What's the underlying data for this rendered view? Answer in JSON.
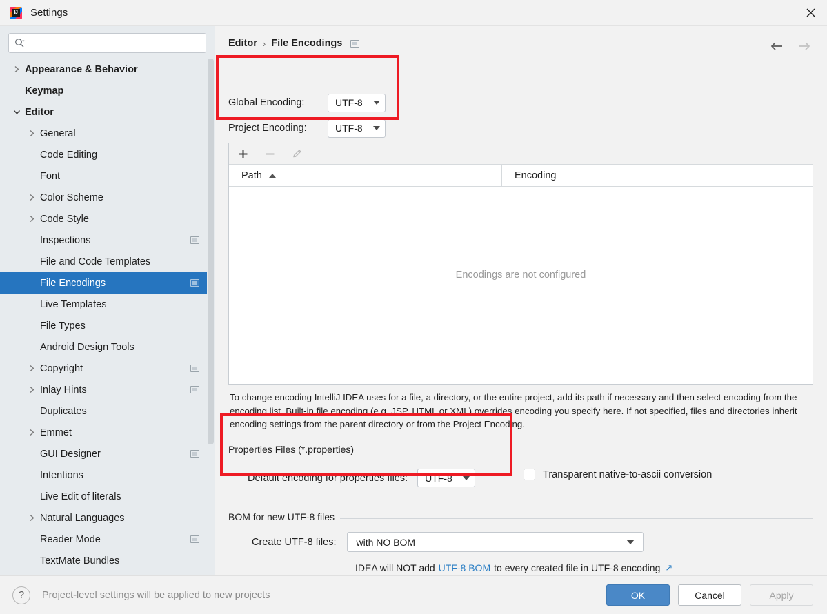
{
  "window": {
    "title": "Settings",
    "logo_text": "IJ",
    "close_icon": "close-icon"
  },
  "sidebar": {
    "search": {
      "value": "",
      "placeholder": ""
    },
    "items": [
      {
        "label": "Appearance & Behavior",
        "level": 0,
        "arrow": "collapsed",
        "badge": false,
        "selected": false
      },
      {
        "label": "Keymap",
        "level": 0,
        "arrow": "none",
        "badge": false,
        "selected": false
      },
      {
        "label": "Editor",
        "level": 0,
        "arrow": "expanded",
        "badge": false,
        "selected": false
      },
      {
        "label": "General",
        "level": 1,
        "arrow": "collapsed",
        "badge": false,
        "selected": false
      },
      {
        "label": "Code Editing",
        "level": 1,
        "arrow": "none",
        "badge": false,
        "selected": false
      },
      {
        "label": "Font",
        "level": 1,
        "arrow": "none",
        "badge": false,
        "selected": false
      },
      {
        "label": "Color Scheme",
        "level": 1,
        "arrow": "collapsed",
        "badge": false,
        "selected": false
      },
      {
        "label": "Code Style",
        "level": 1,
        "arrow": "collapsed",
        "badge": false,
        "selected": false
      },
      {
        "label": "Inspections",
        "level": 1,
        "arrow": "none",
        "badge": true,
        "selected": false
      },
      {
        "label": "File and Code Templates",
        "level": 1,
        "arrow": "none",
        "badge": false,
        "selected": false
      },
      {
        "label": "File Encodings",
        "level": 1,
        "arrow": "none",
        "badge": true,
        "selected": true
      },
      {
        "label": "Live Templates",
        "level": 1,
        "arrow": "none",
        "badge": false,
        "selected": false
      },
      {
        "label": "File Types",
        "level": 1,
        "arrow": "none",
        "badge": false,
        "selected": false
      },
      {
        "label": "Android Design Tools",
        "level": 1,
        "arrow": "none",
        "badge": false,
        "selected": false
      },
      {
        "label": "Copyright",
        "level": 1,
        "arrow": "collapsed",
        "badge": true,
        "selected": false
      },
      {
        "label": "Inlay Hints",
        "level": 1,
        "arrow": "collapsed",
        "badge": true,
        "selected": false
      },
      {
        "label": "Duplicates",
        "level": 1,
        "arrow": "none",
        "badge": false,
        "selected": false
      },
      {
        "label": "Emmet",
        "level": 1,
        "arrow": "collapsed",
        "badge": false,
        "selected": false
      },
      {
        "label": "GUI Designer",
        "level": 1,
        "arrow": "none",
        "badge": true,
        "selected": false
      },
      {
        "label": "Intentions",
        "level": 1,
        "arrow": "none",
        "badge": false,
        "selected": false
      },
      {
        "label": "Live Edit of literals",
        "level": 1,
        "arrow": "none",
        "badge": false,
        "selected": false
      },
      {
        "label": "Natural Languages",
        "level": 1,
        "arrow": "collapsed",
        "badge": false,
        "selected": false
      },
      {
        "label": "Reader Mode",
        "level": 1,
        "arrow": "none",
        "badge": true,
        "selected": false
      },
      {
        "label": "TextMate Bundles",
        "level": 1,
        "arrow": "none",
        "badge": false,
        "selected": false
      }
    ]
  },
  "content": {
    "breadcrumb": {
      "parent": "Editor",
      "separator": "›",
      "current": "File Encodings"
    },
    "nav": {
      "back_icon": "arrow-left-icon",
      "forward_icon": "arrow-right-icon"
    },
    "global_encoding": {
      "label": "Global Encoding:",
      "value": "UTF-8"
    },
    "project_encoding": {
      "label": "Project Encoding:",
      "value": "UTF-8"
    },
    "toolbar": {
      "add_icon": "plus-icon",
      "remove_icon": "minus-icon",
      "edit_icon": "pencil-icon"
    },
    "table": {
      "columns": [
        "Path",
        "Encoding"
      ],
      "sort_column": "Path",
      "sort_direction": "ascending",
      "rows": [],
      "empty_text": "Encodings are not configured"
    },
    "help_text": "To change encoding IntelliJ IDEA uses for a file, a directory, or the entire project, add its path if necessary and then select encoding from the encoding list. Built-in file encoding (e.g. JSP, HTML or XML) overrides encoding you specify here. If not specified, files and directories inherit encoding settings from the parent directory or from the Project Encoding.",
    "properties_group": {
      "title": "Properties Files (*.properties)",
      "default_encoding_label": "Default encoding for properties files:",
      "default_encoding_value": "UTF-8",
      "transparent_label": "Transparent native-to-ascii conversion",
      "transparent_checked": false
    },
    "bom_group": {
      "title": "BOM for new UTF-8 files",
      "create_label": "Create UTF-8 files:",
      "create_value": "with NO BOM",
      "note_prefix": "IDEA will NOT add",
      "note_link": "UTF-8 BOM",
      "note_suffix": "to every created file in UTF-8 encoding",
      "external_link_icon": "↗"
    }
  },
  "bottom": {
    "help_icon": "?",
    "note": "Project-level settings will be applied to new projects",
    "ok_label": "OK",
    "cancel_label": "Cancel",
    "apply_label": "Apply"
  },
  "annotations": {
    "highlight_color": "#ee1b24",
    "boxes": [
      {
        "name": "encodings-highlight"
      },
      {
        "name": "properties-highlight"
      }
    ]
  },
  "colors": {
    "selection_blue": "#2675bf",
    "ok_button_blue": "#4a88c7",
    "link_blue": "#2a7ec4",
    "sidebar_bg": "#e7ebee",
    "panel_bg": "#f2f2f2"
  }
}
